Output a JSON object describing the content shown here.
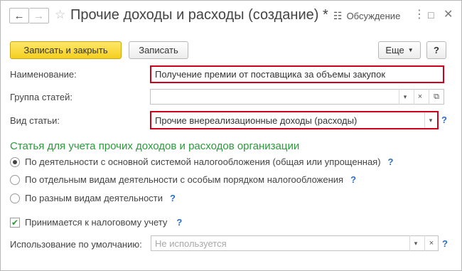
{
  "window": {
    "title": "Прочие доходы и расходы (создание) *",
    "discussion_label": "Обсуждение",
    "back_icon": "arrow-left",
    "forward_icon": "arrow-right"
  },
  "toolbar": {
    "save_close_label": "Записать и закрыть",
    "save_label": "Записать",
    "more_label": "Еще",
    "help_label": "?"
  },
  "form": {
    "name": {
      "label": "Наименование:",
      "value": "Получение премии от поставщика за объемы закупок"
    },
    "group": {
      "label": "Группа статей:",
      "value": ""
    },
    "kind": {
      "label": "Вид статьи:",
      "value": "Прочие внереализационные доходы (расходы)"
    },
    "section_title": "Статья для учета прочих доходов и расходов организации",
    "radios": [
      {
        "label": "По деятельности с основной системой налогообложения (общая или упрощенная)",
        "selected": true
      },
      {
        "label": "По отдельным видам деятельности с особым порядком налогообложения",
        "selected": false
      },
      {
        "label": "По разным видам деятельности",
        "selected": false
      }
    ],
    "tax_accounting": {
      "label": "Принимается к налоговому учету",
      "checked": true
    },
    "default_usage": {
      "label": "Использование по умолчанию:",
      "placeholder": "Не используется"
    },
    "help_mark": "?"
  },
  "colors": {
    "primary_button": "#f4cf1e",
    "highlight": "#d0021b",
    "section": "#2a9a3a",
    "help": "#2b6fc2"
  }
}
